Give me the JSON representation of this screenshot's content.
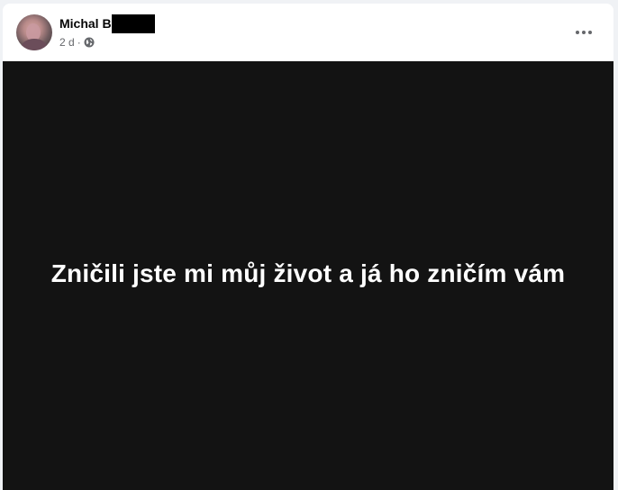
{
  "post": {
    "author": {
      "name": "Michal B",
      "name_redacted": true
    },
    "meta": {
      "time": "2 d",
      "separator": "·",
      "audience_icon": "globe-icon"
    },
    "menu_icon": "more-options-icon",
    "text": "Zničili jste mi můj život a já ho zničím vám",
    "colors": {
      "background": "#131313",
      "text": "#ffffff",
      "meta": "#65676b"
    }
  }
}
